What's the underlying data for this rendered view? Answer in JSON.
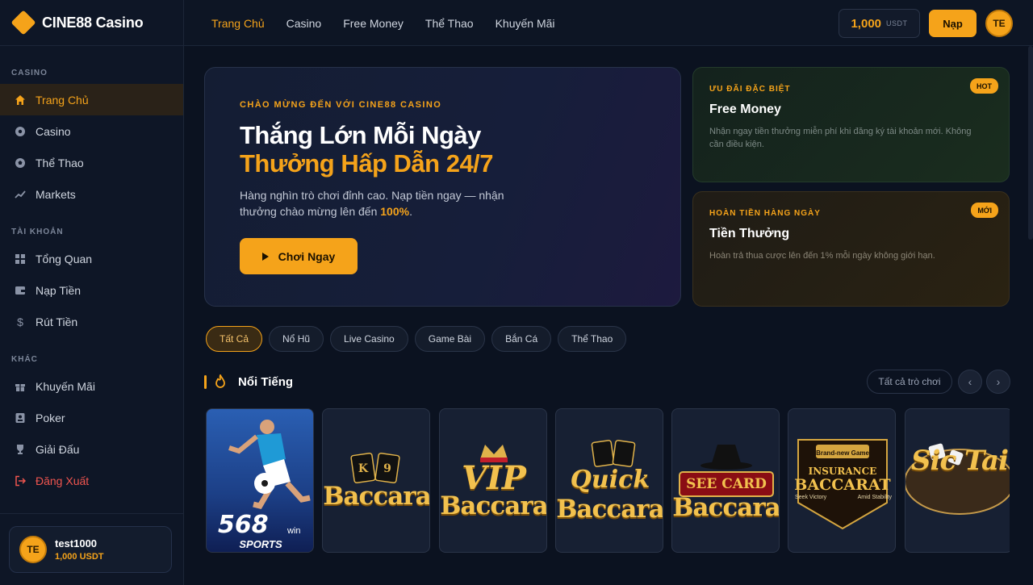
{
  "brand": {
    "name": "CINE88 Casino"
  },
  "sidebar": {
    "sections": [
      {
        "title": "CASINO",
        "items": [
          {
            "label": "Trang Chủ",
            "icon": "home-icon",
            "active": true
          },
          {
            "label": "Casino",
            "icon": "chip-icon"
          },
          {
            "label": "Thể Thao",
            "icon": "ball-icon"
          },
          {
            "label": "Markets",
            "icon": "trend-icon"
          }
        ]
      },
      {
        "title": "TÀI KHOẢN",
        "items": [
          {
            "label": "Tổng Quan",
            "icon": "grid-icon"
          },
          {
            "label": "Nạp Tiền",
            "icon": "wallet-icon"
          },
          {
            "label": "Rút Tiền",
            "icon": "dollar-icon"
          }
        ]
      },
      {
        "title": "KHÁC",
        "items": [
          {
            "label": "Khuyến Mãi",
            "icon": "gift-icon"
          },
          {
            "label": "Poker",
            "icon": "card-icon"
          },
          {
            "label": "Giải Đấu",
            "icon": "trophy-icon"
          },
          {
            "label": "Đăng Xuất",
            "icon": "logout-icon"
          }
        ]
      }
    ],
    "user": {
      "initials": "TE",
      "name": "test1000",
      "balance": "1,000 USDT"
    }
  },
  "topbar": {
    "nav": [
      "Trang Chủ",
      "Casino",
      "Free Money",
      "Thể Thao",
      "Khuyến Mãi"
    ],
    "balance_amount": "1,000",
    "balance_unit": "USDT",
    "deposit_label": "Nạp",
    "avatar_initials": "TE"
  },
  "hero": {
    "eyebrow": "CHÀO MỪNG ĐẾN VỚI CINE88 CASINO",
    "title_line1": "Thắng Lớn Mỗi Ngày",
    "title_line2": "Thưởng Hấp Dẫn 24/7",
    "desc_text": "Hàng nghìn trò chơi đỉnh cao. Nạp tiền ngay — nhận thưởng chào mừng lên đến ",
    "desc_highlight": "100%",
    "desc_end": ".",
    "cta_label": "Chơi Ngay"
  },
  "promos": [
    {
      "eyebrow": "ƯU ĐÃI ĐẶC BIỆT",
      "title": "Free Money",
      "desc": "Nhận ngay tiền thưởng miễn phí khi đăng ký tài khoản mới. Không cần điều kiện.",
      "badge": "HOT"
    },
    {
      "eyebrow": "HOÀN TIỀN HÀNG NGÀY",
      "title": "Tiền Thưởng",
      "desc": "Hoàn trả thua cược lên đến 1% mỗi ngày không giới hạn.",
      "badge": "MỚI"
    }
  ],
  "filters": [
    "Tất Cả",
    "Nổ Hũ",
    "Live Casino",
    "Game Bài",
    "Bắn Cá",
    "Thể Thao"
  ],
  "section": {
    "title": "Nổi Tiếng",
    "see_all": "Tất cả trò chơi"
  },
  "games": [
    {
      "name": "568win SPORTS",
      "top": "568",
      "suffix": "win",
      "bottom": "SPORTS"
    },
    {
      "name": "Baccarat",
      "word": "Baccara"
    },
    {
      "name": "VIP Baccarat",
      "top": "VIP",
      "word": "Baccara"
    },
    {
      "name": "Quick Baccarat",
      "top": "Quick",
      "word": "Baccara"
    },
    {
      "name": "See Card Baccarat",
      "top": "SEE CARD",
      "word": "Baccara"
    },
    {
      "name": "Insurance Baccarat",
      "tag": "Brand-new Game",
      "top": "INSURANCE",
      "word": "BACCARAT",
      "left": "Seek Victory",
      "right": "Amid Stability"
    },
    {
      "name": "Sic Tai",
      "word": "Sic Tai"
    }
  ]
}
